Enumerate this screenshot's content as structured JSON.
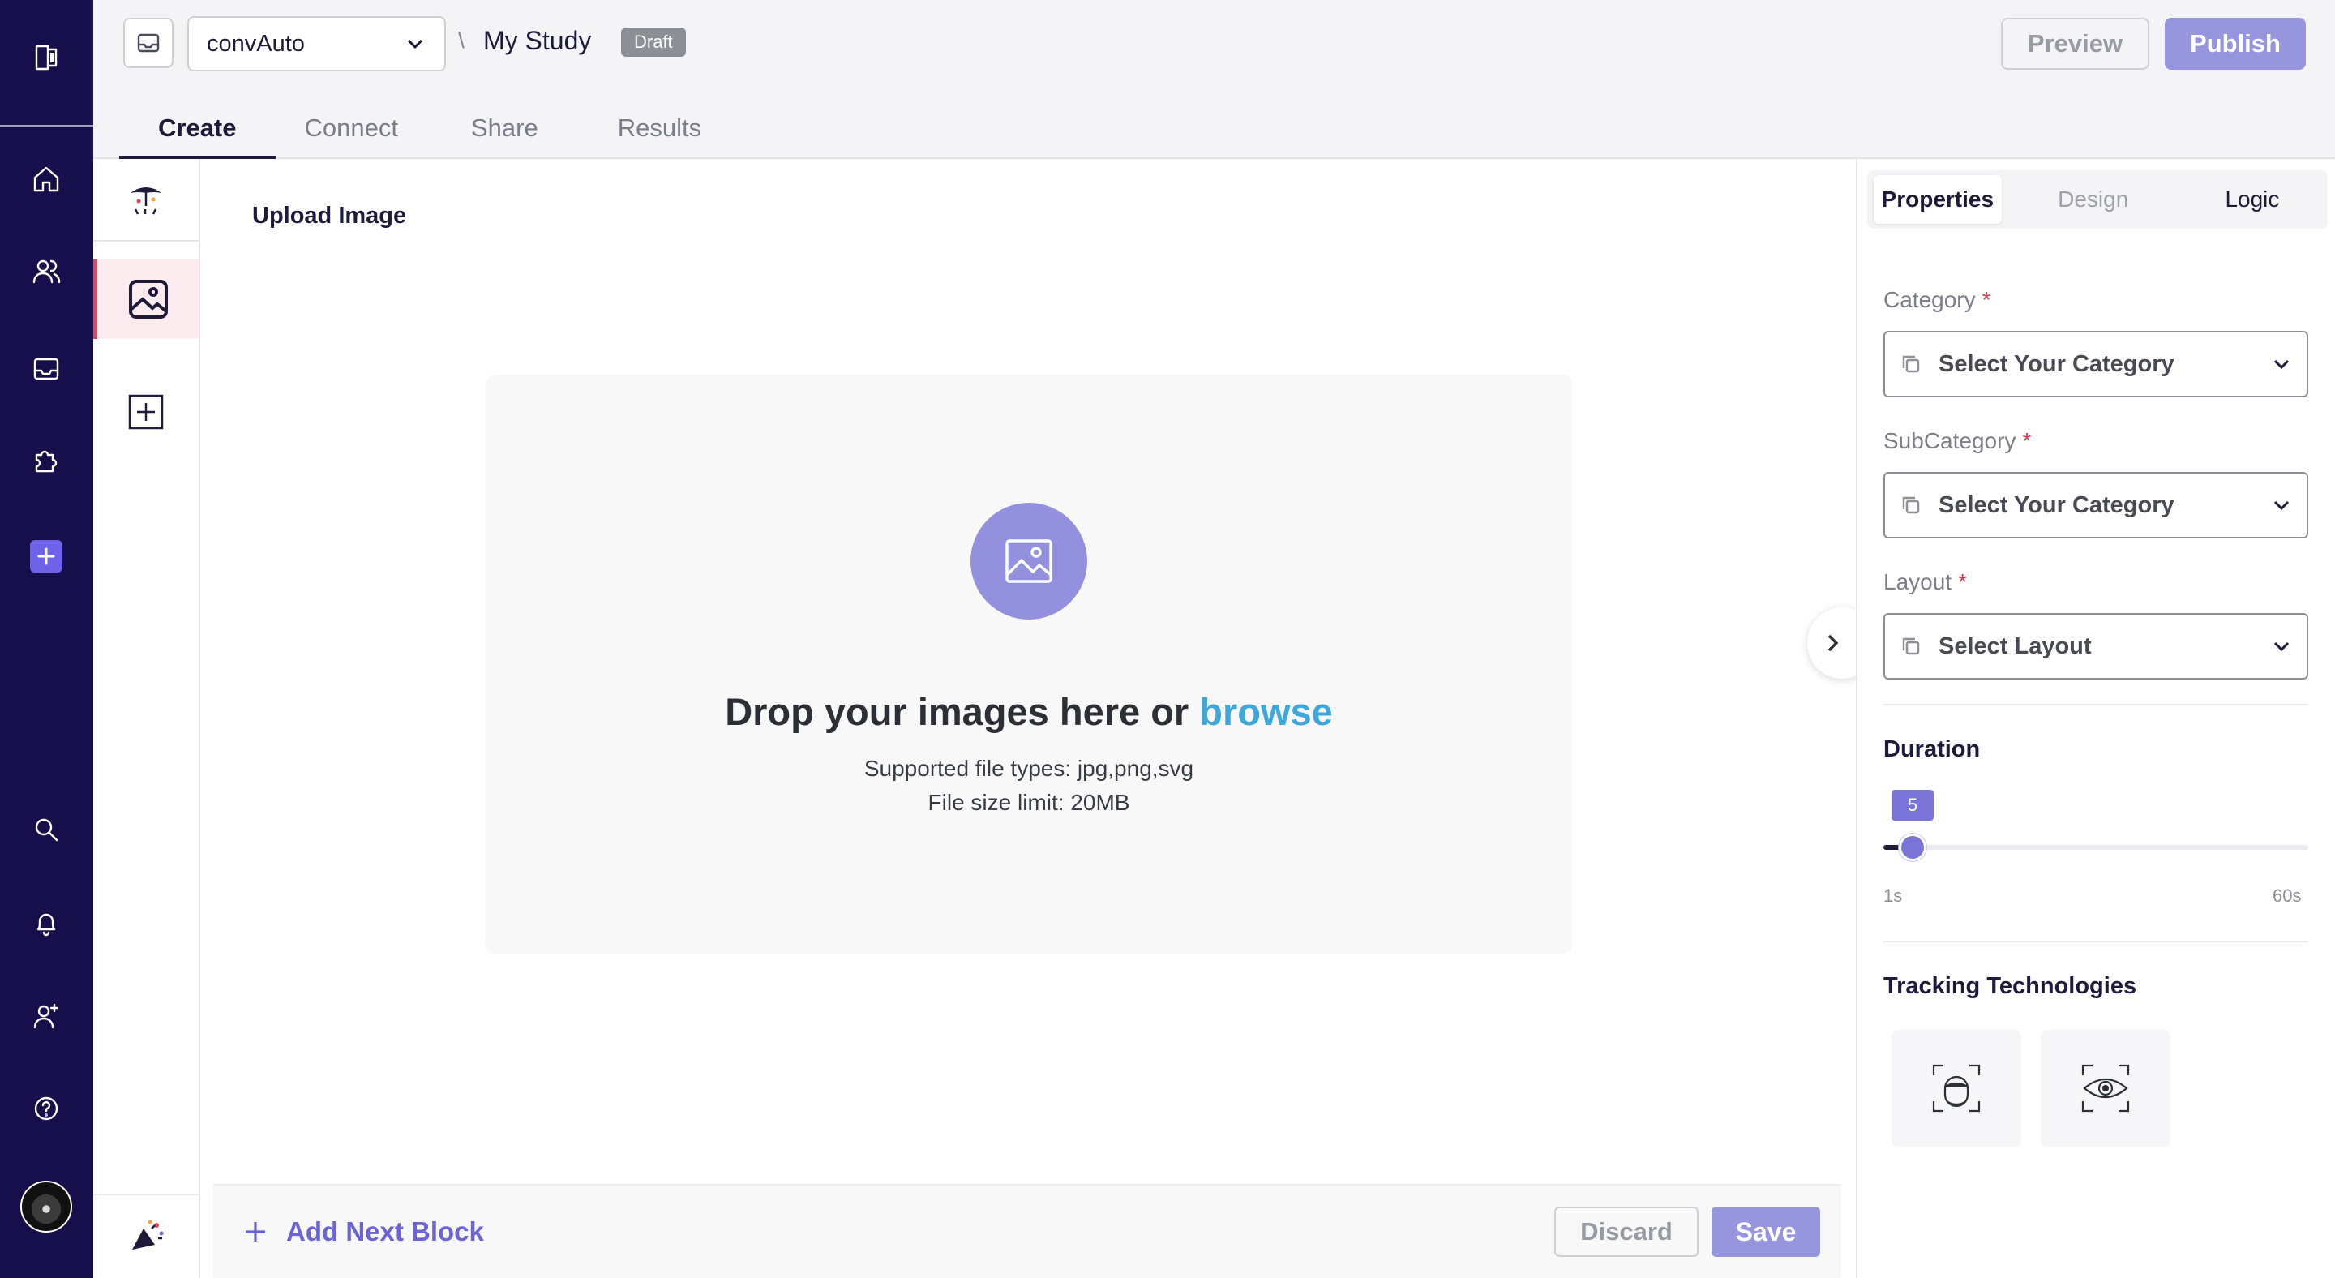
{
  "nav": {
    "items": [
      "logo-icon",
      "home-icon",
      "users-icon",
      "inbox-icon",
      "puzzle-icon",
      "plus-icon",
      "search-icon",
      "bell-icon",
      "user-add-icon",
      "help-icon"
    ],
    "accent_color": "#160f4b"
  },
  "header": {
    "workspace": "convAuto",
    "breadcrumb_separator": "\\",
    "study_title": "My Study",
    "status_badge": "Draft",
    "preview_label": "Preview",
    "publish_label": "Publish",
    "tabs": [
      {
        "label": "Create",
        "active": true
      },
      {
        "label": "Connect",
        "active": false
      },
      {
        "label": "Share",
        "active": false
      },
      {
        "label": "Results",
        "active": false
      }
    ]
  },
  "editor": {
    "block_title": "Upload Image",
    "dropzone": {
      "heading_prefix": "Drop your images here or ",
      "browse_label": "browse",
      "file_types": "Supported file types: jpg,png,svg",
      "size_limit": "File size limit: 20MB"
    },
    "footer": {
      "add_next_label": "Add Next Block",
      "discard_label": "Discard",
      "save_label": "Save"
    }
  },
  "properties": {
    "tabs": [
      {
        "label": "Properties",
        "active": true
      },
      {
        "label": "Design",
        "active": false
      },
      {
        "label": "Logic",
        "active": false
      }
    ],
    "category": {
      "label": "Category",
      "required_mark": "*",
      "placeholder": "Select Your Category"
    },
    "subcategory": {
      "label": "SubCategory",
      "required_mark": "*",
      "placeholder": "Select Your Category"
    },
    "layout": {
      "label": "Layout",
      "required_mark": "*",
      "placeholder": "Select Layout"
    },
    "duration": {
      "label": "Duration",
      "value": 5,
      "value_text": "5",
      "min": 1,
      "max": 60,
      "min_label": "1s",
      "max_label": "60s"
    },
    "tracking": {
      "label": "Tracking Technologies",
      "options": [
        "face-tracking-icon",
        "eye-tracking-icon"
      ]
    }
  }
}
